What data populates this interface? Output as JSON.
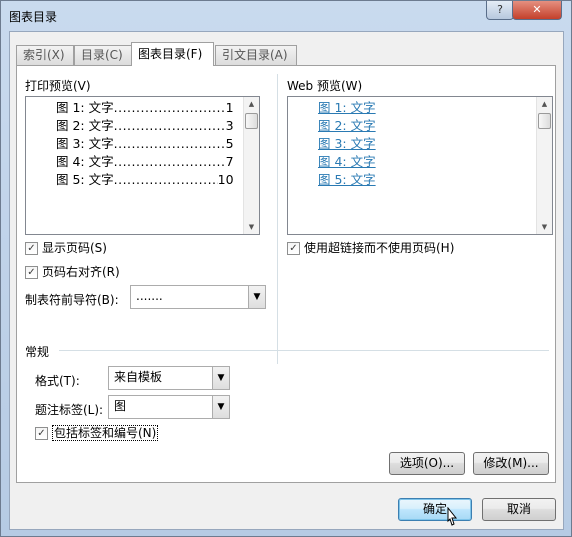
{
  "window": {
    "title": "图表目录",
    "help_glyph": "?",
    "close_glyph": "✕"
  },
  "tabs": [
    {
      "label": "索引(X)",
      "active": false
    },
    {
      "label": "目录(C)",
      "active": false
    },
    {
      "label": "图表目录(F)",
      "active": true
    },
    {
      "label": "引文目录(A)",
      "active": false
    }
  ],
  "print_preview": {
    "label": "打印预览(V)",
    "entries": [
      {
        "text": "图 1: 文字",
        "page": "1"
      },
      {
        "text": "图 2: 文字",
        "page": "3"
      },
      {
        "text": "图 3: 文字",
        "page": "5"
      },
      {
        "text": "图 4: 文字",
        "page": "7"
      },
      {
        "text": "图 5: 文字",
        "page": "10"
      }
    ],
    "leader": "........................................"
  },
  "web_preview": {
    "label": "Web 预览(W)",
    "entries": [
      "图 1: 文字",
      "图 2: 文字",
      "图 3: 文字",
      "图 4: 文字",
      "图 5: 文字"
    ]
  },
  "options": {
    "show_page_numbers": {
      "label": "显示页码(S)",
      "checked": true
    },
    "right_align": {
      "label": "页码右对齐(R)",
      "checked": true
    },
    "use_hyperlinks": {
      "label": "使用超链接而不使用页码(H)",
      "checked": true
    },
    "tab_leader": {
      "label": "制表符前导符(B):",
      "value": "......."
    }
  },
  "general": {
    "label": "常规",
    "format": {
      "label": "格式(T):",
      "value": "来自模板"
    },
    "caption_label": {
      "label": "题注标签(L):",
      "value": "图"
    },
    "include_label": {
      "label": "包括标签和编号(N)",
      "checked": true
    }
  },
  "buttons": {
    "options": "选项(O)...",
    "modify": "修改(M)...",
    "ok": "确定",
    "cancel": "取消"
  },
  "check_glyph": "✓",
  "dropdown_glyph": "▼",
  "scroll_up_glyph": "▲",
  "scroll_down_glyph": "▼",
  "colors": {
    "link": "#2a7ab3",
    "titlebar": "#c9daee",
    "close": "#c4402b"
  }
}
